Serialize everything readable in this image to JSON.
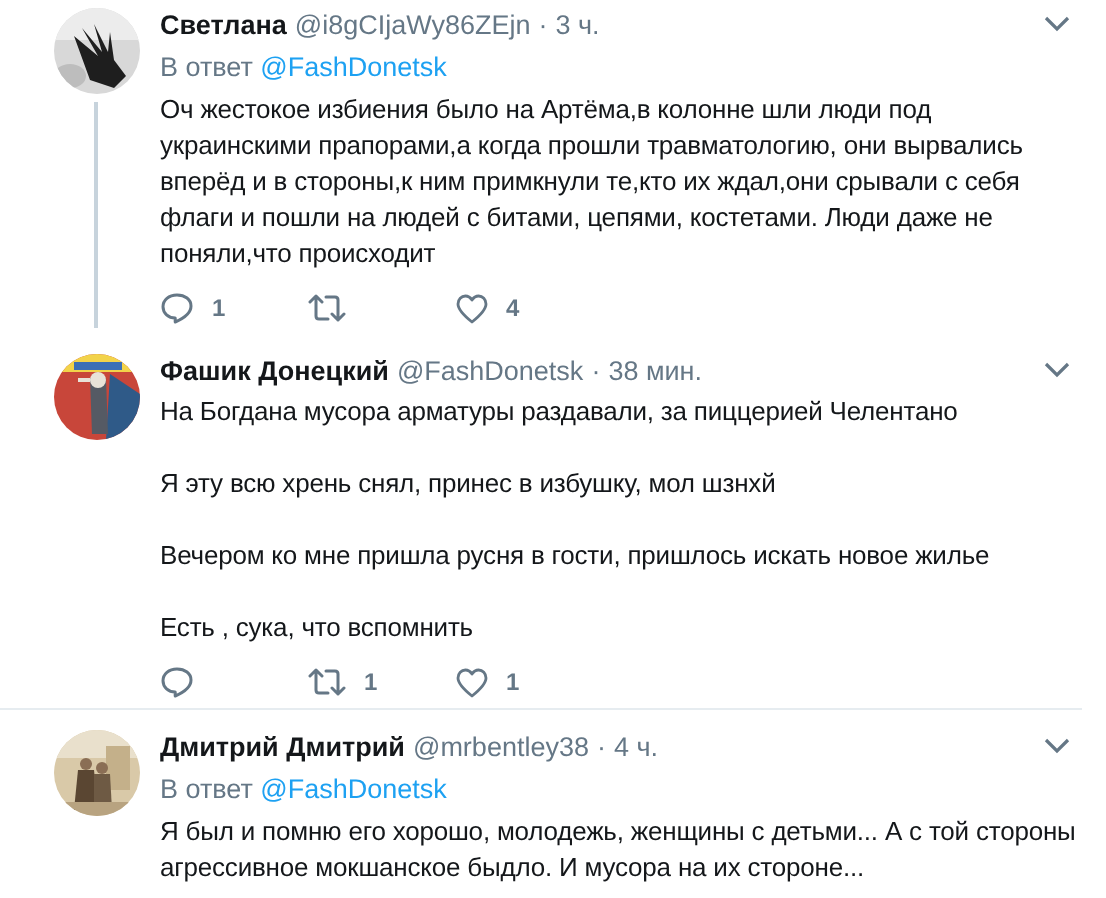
{
  "tweets": [
    {
      "name": "Светлана",
      "handle": "@i8gCIjaWy86ZEjn",
      "separator": "·",
      "time": "3 ч.",
      "threaded": true,
      "reply_to": {
        "prefix": "В ответ",
        "handle": "@FashDonetsk"
      },
      "paragraphs": [
        "Оч жестокое избиения было на Артёма,в колонне шли люди под украинскими прапорами,а когда прошли травматологию, они вырвались вперёд и в стороны,к ним примкнули те,кто их ждал,они срывали с себя флаги и пошли на людей с битами, цепями, костетами. Люди даже не поняли,что происходит"
      ],
      "actions": {
        "replies": "1",
        "likes": "4"
      }
    },
    {
      "name": "Фашик Донецкий",
      "handle": "@FashDonetsk",
      "separator": "·",
      "time": "38 мин.",
      "threaded": false,
      "paragraphs": [
        "На Богдана мусора арматуры раздавали,  за пиццерией Челентано",
        "Я эту всю хрень снял, принес в избушку, мол шзнхй",
        "Вечером ко мне пришла русня в гости, пришлось искать новое жилье",
        "Есть , сука, что вспомнить"
      ],
      "actions": {
        "retweets": "1",
        "likes": "1"
      }
    },
    {
      "name": "Дмитрий Дмитрий",
      "handle": "@mrbentley38",
      "separator": "·",
      "time": "4 ч.",
      "threaded": false,
      "reply_to": {
        "prefix": "В ответ",
        "handle": "@FashDonetsk"
      },
      "paragraphs": [
        "Я был и помню его хорошо, молодежь, женщины с детьми... А с той стороны агрессивное мокшанское быдло. И мусора на их стороне..."
      ]
    }
  ]
}
